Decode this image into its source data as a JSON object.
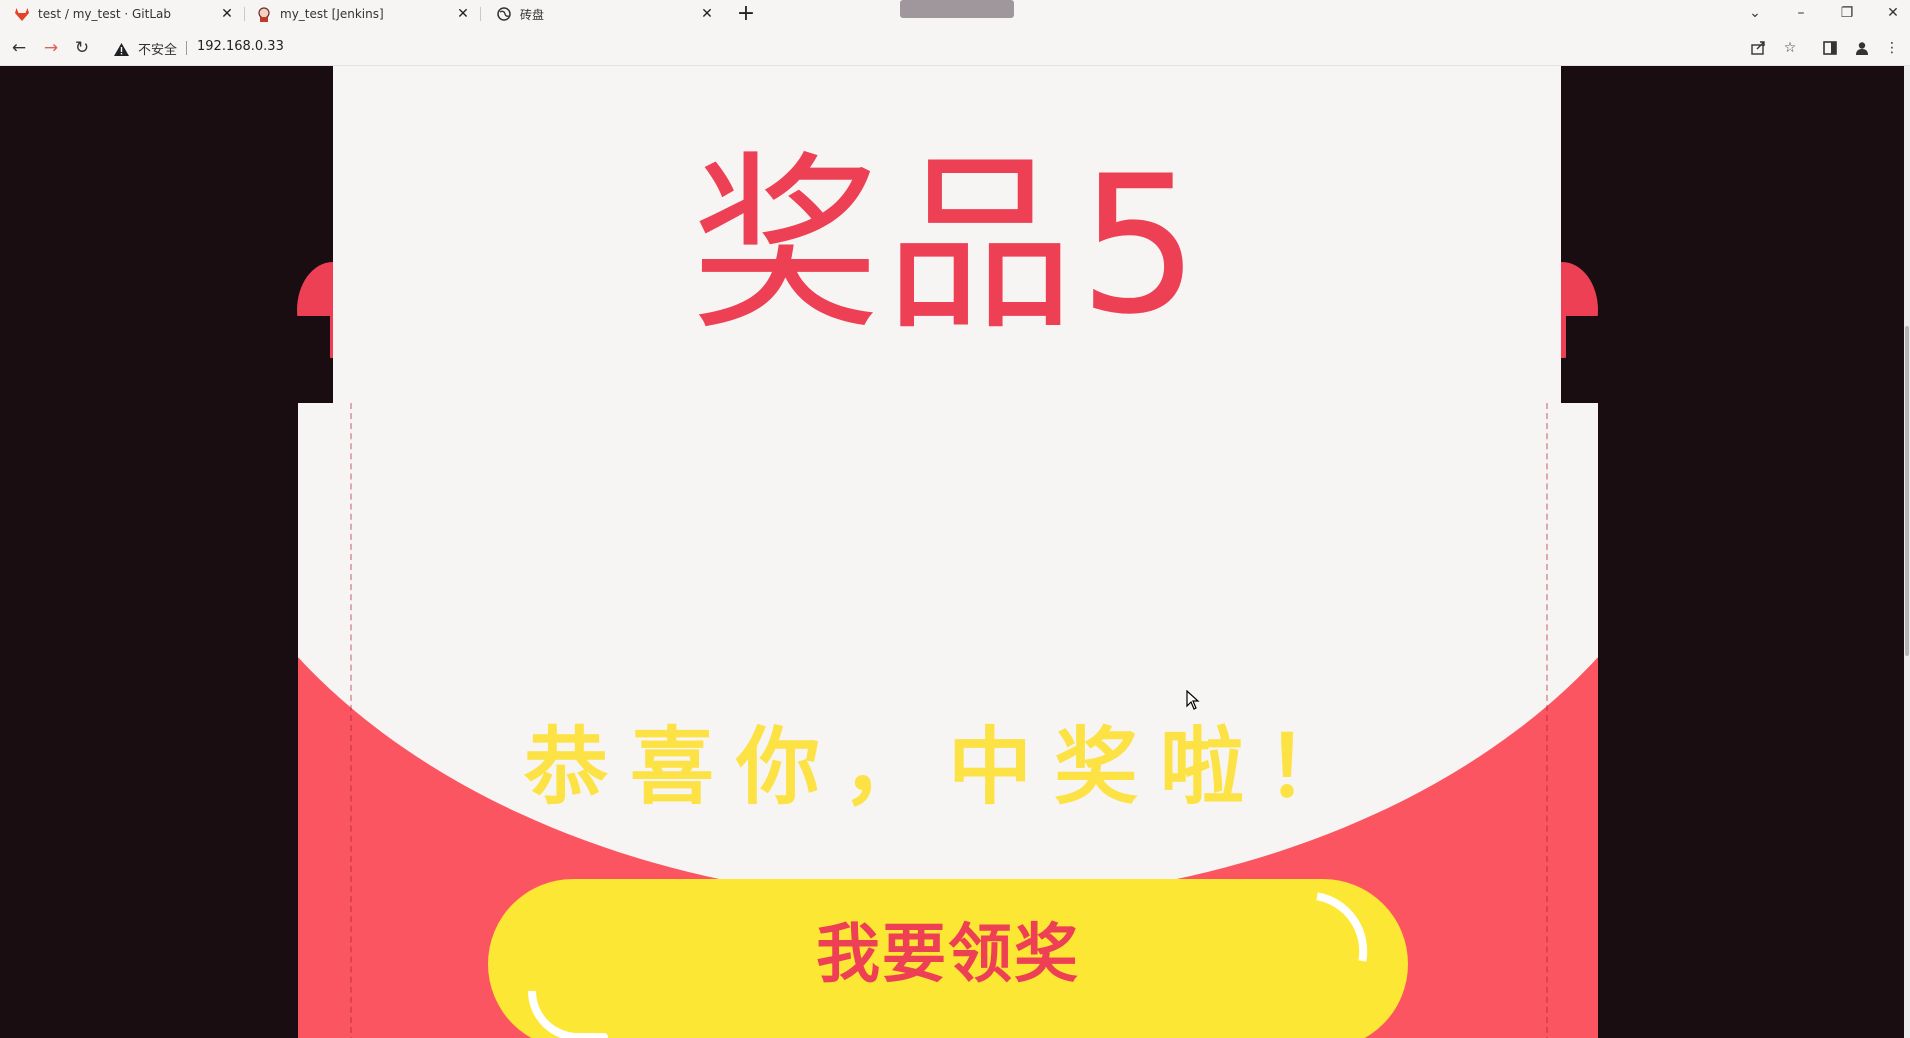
{
  "browser": {
    "tabs": [
      {
        "title": "test / my_test · GitLab",
        "icon": "gitlab-icon"
      },
      {
        "title": "my_test [Jenkins]",
        "icon": "jenkins-icon"
      },
      {
        "title": "砖盘",
        "icon": "globe-icon"
      }
    ],
    "address": {
      "security_label": "不安全",
      "url": "192.168.0.33"
    }
  },
  "page": {
    "prize_title": "奖品5",
    "congrats_text": "恭喜你，中奖啦！",
    "claim_button_label": "我要领奖"
  },
  "colors": {
    "card_bg": "#f7f5f4",
    "pocket_red": "#fc5562",
    "prize_red": "#ee4055",
    "yellow": "#fce834",
    "backdrop": "#1a0d12"
  }
}
